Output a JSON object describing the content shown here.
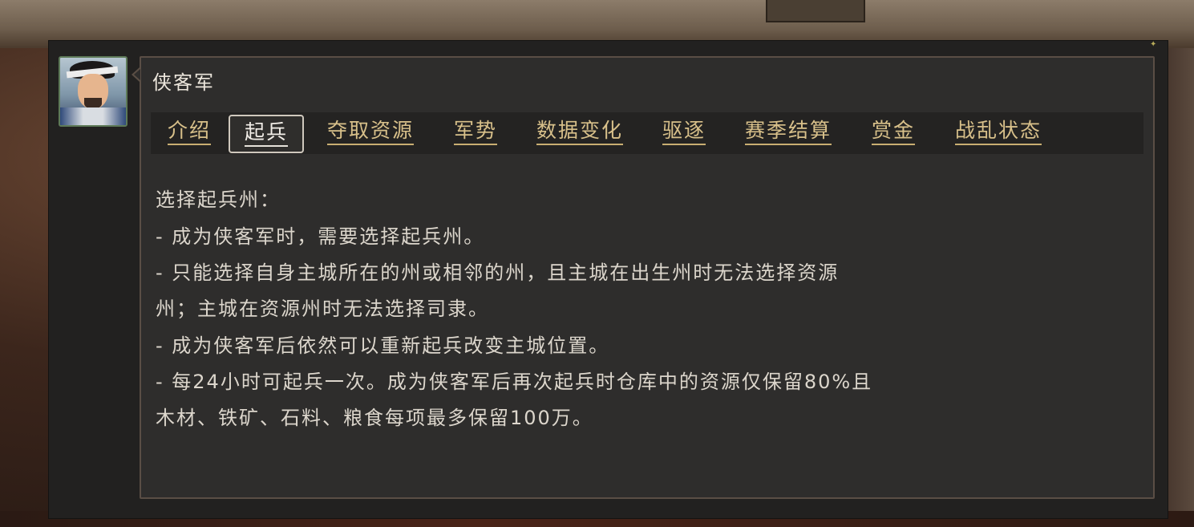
{
  "window": {
    "title": "侠客军"
  },
  "tabs": [
    {
      "label": "介绍",
      "active": false
    },
    {
      "label": "起兵",
      "active": true
    },
    {
      "label": "夺取资源",
      "active": false
    },
    {
      "label": "军势",
      "active": false
    },
    {
      "label": "数据变化",
      "active": false
    },
    {
      "label": "驱逐",
      "active": false
    },
    {
      "label": "赛季结算",
      "active": false
    },
    {
      "label": "赏金",
      "active": false
    },
    {
      "label": "战乱状态",
      "active": false
    }
  ],
  "content": {
    "lines": [
      "选择起兵州：",
      "- 成为侠客军时，需要选择起兵州。",
      "- 只能选择自身主城所在的州或相邻的州，且主城在出生州时无法选择资源",
      "州；主城在资源州时无法选择司隶。",
      "- 成为侠客军后依然可以重新起兵改变主城位置。",
      "- 每24小时可起兵一次。成为侠客军后再次起兵时仓库中的资源仅保留80%且",
      "木材、铁矿、石料、粮食每项最多保留100万。"
    ]
  },
  "colors": {
    "panel_bg": "#2e2d2c",
    "tab_text": "#d8c08a",
    "active_tab_text": "#f2eee8",
    "body_text": "#dcd6cc"
  }
}
